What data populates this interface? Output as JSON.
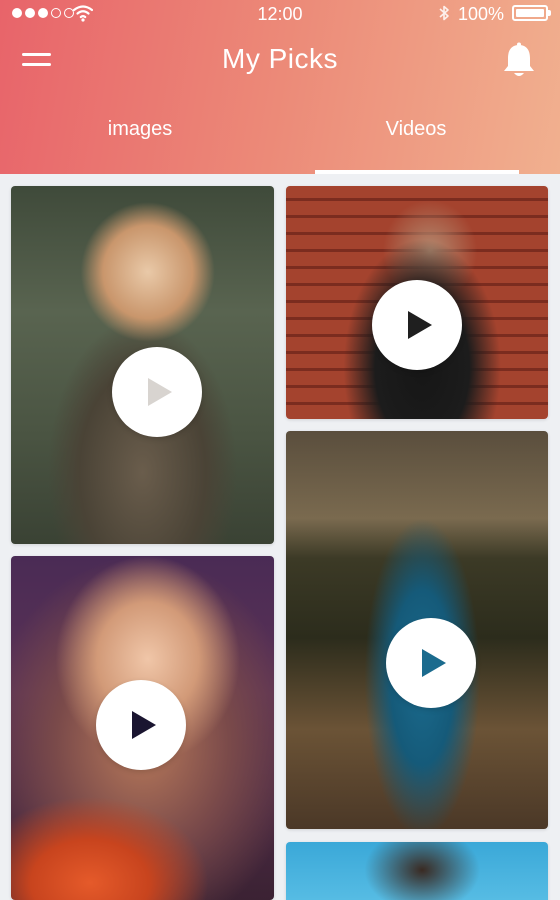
{
  "status_bar": {
    "time": "12:00",
    "battery": "100%",
    "signal_icon": "signal-dots-icon",
    "wifi_icon": "wifi-icon",
    "bluetooth_icon": "bluetooth-icon",
    "battery_icon": "battery-icon"
  },
  "header": {
    "title": "My Picks",
    "menu_icon": "hamburger-menu-icon",
    "notification_icon": "bell-icon",
    "gradient_colors": [
      "#e8646a",
      "#f1b08f"
    ]
  },
  "tabs": [
    {
      "label": "images",
      "active": false
    },
    {
      "label": "Videos",
      "active": true
    }
  ],
  "videos": [
    {
      "id": "video-1",
      "play_icon": "play-icon",
      "play_color": "#d8d4d0"
    },
    {
      "id": "video-2",
      "play_icon": "play-icon",
      "play_color": "#1f1f1f"
    },
    {
      "id": "video-3",
      "play_icon": "play-icon",
      "play_color": "#1b6b8e"
    },
    {
      "id": "video-4",
      "play_icon": "play-icon",
      "play_color": "#1a1530"
    },
    {
      "id": "video-5",
      "play_icon": "play-icon",
      "play_color": "#ffffff"
    }
  ]
}
